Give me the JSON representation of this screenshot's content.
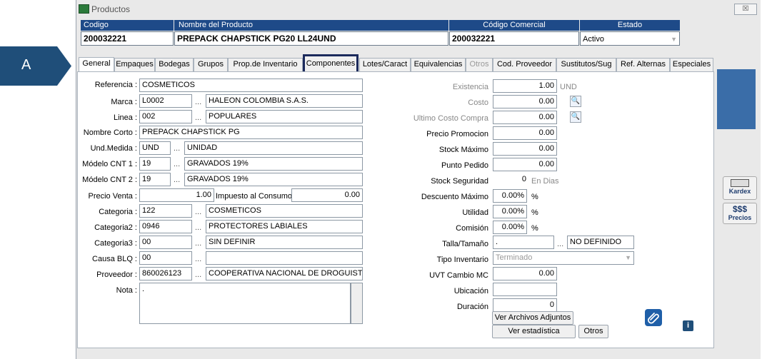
{
  "window": {
    "title": "Productos",
    "close": "☒"
  },
  "header": {
    "codigo_label": "Codigo",
    "codigo_value": "200032221",
    "nombre_label": "Nombre del Producto",
    "nombre_value": "PREPACK CHAPSTICK PG20 LL24UND",
    "comercial_label": "Código Comercial",
    "comercial_value": "200032221",
    "estado_label": "Estado",
    "estado_value": "Activo"
  },
  "marker": {
    "label": "A"
  },
  "tabs": [
    "General",
    "Empaques",
    "Bodegas",
    "Grupos",
    "Prop.de Inventario",
    "Componentes",
    "Lotes/Caract",
    "Equivalencias",
    "Otros",
    "Cod. Proveedor",
    "Sustitutos/Sug",
    "Ref. Alternas",
    "Especiales"
  ],
  "left": {
    "referencia": {
      "label": "Referencia :",
      "value": "COSMETICOS"
    },
    "marca": {
      "label": "Marca :",
      "code": "L0002",
      "name": "HALEON COLOMBIA S.A.S."
    },
    "linea": {
      "label": "Linea :",
      "code": "002",
      "name": "POPULARES"
    },
    "nombre_corto": {
      "label": "Nombre Corto :",
      "value": "PREPACK CHAPSTICK PG"
    },
    "und_medida": {
      "label": "Und.Medida :",
      "code": "UND",
      "name": "UNIDAD"
    },
    "cnt1": {
      "label": "Módelo CNT 1 :",
      "code": "19",
      "name": "GRAVADOS 19%"
    },
    "cnt2": {
      "label": "Módelo CNT 2 :",
      "code": "19",
      "name": "GRAVADOS 19%"
    },
    "precio_venta": {
      "label": "Precio Venta :",
      "value": "1.00",
      "impuesto_label": "Impuesto al Consumo",
      "impuesto_value": "0.00"
    },
    "categoria": {
      "label": "Categoria :",
      "code": "122",
      "name": "COSMETICOS"
    },
    "categoria2": {
      "label": "Categoria2 :",
      "code": "0946",
      "name": "PROTECTORES LABIALES"
    },
    "categoria3": {
      "label": "Categoria3 :",
      "code": "00",
      "name": "SIN DEFINIR"
    },
    "causa_blq": {
      "label": "Causa BLQ :",
      "code": "00",
      "name": ""
    },
    "proveedor": {
      "label": "Proveedor :",
      "code": "860026123",
      "name": "COOPERATIVA NACIONAL DE DROGUISTAS D"
    },
    "nota": {
      "label": "Nota :",
      "value": "."
    },
    "dots": "..."
  },
  "right": {
    "existencia": {
      "label": "Existencia",
      "value": "1.00",
      "unit": "UND"
    },
    "costo": {
      "label": "Costo",
      "value": "0.00"
    },
    "ultimo_costo": {
      "label": "Ultimo Costo Compra",
      "value": "0.00"
    },
    "precio_promocion": {
      "label": "Precio Promocion",
      "value": "0.00"
    },
    "stock_maximo": {
      "label": "Stock Máximo",
      "value": "0.00"
    },
    "punto_pedido": {
      "label": "Punto Pedido",
      "value": "0.00"
    },
    "stock_seguridad": {
      "label": "Stock Seguridad",
      "value": "0",
      "unit": "En Dias"
    },
    "descuento_maximo": {
      "label": "Descuento Máximo",
      "value": "0.00%",
      "unit": "%"
    },
    "utilidad": {
      "label": "Utilidad",
      "value": "0.00%",
      "unit": "%"
    },
    "comision": {
      "label": "Comisión",
      "value": "0.00%",
      "unit": "%"
    },
    "talla": {
      "label": "Talla/Tamaño",
      "code": ".",
      "name": "NO DEFINIDO"
    },
    "tipo_inventario": {
      "label": "Tipo Inventario",
      "value": "Terminado"
    },
    "uvt": {
      "label": "UVT Cambio MC",
      "value": "0.00"
    },
    "ubicacion": {
      "label": "Ubicación",
      "value": ""
    },
    "duracion": {
      "label": "Duración",
      "value": "0"
    }
  },
  "buttons": {
    "ver_archivos": "Ver Archivos Adjuntos",
    "ver_estadistica": "Ver estadística",
    "otros": "Otros",
    "clip_icon": "paperclip-icon",
    "info_icon": "info-icon"
  },
  "side": {
    "kardex": "Kardex",
    "precios_symbol": "$$$",
    "precios": "Precios"
  }
}
